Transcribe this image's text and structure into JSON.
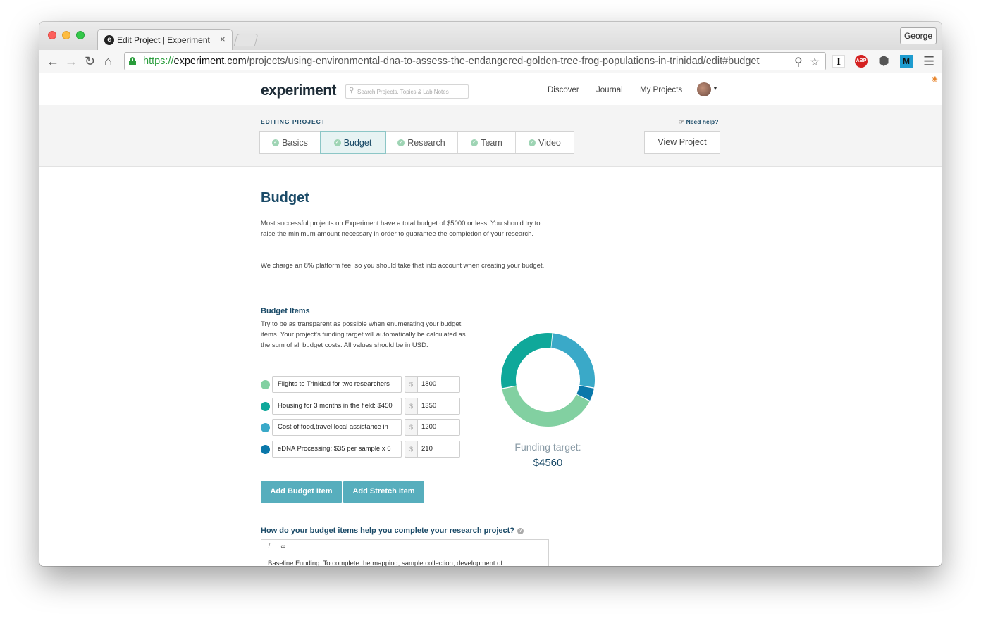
{
  "browser": {
    "tab_title": "Edit Project | Experiment",
    "tab_favicon": "e",
    "tab_close": "×",
    "profile_name": "George",
    "url_scheme": "https://",
    "url_host": "experiment.com",
    "url_path": "/projects/using-environmental-dna-to-assess-the-endangered-golden-tree-frog-populations-in-trinidad/edit#budget",
    "extensions": [
      {
        "name": "instapaper-extension-icon",
        "label": "I"
      },
      {
        "name": "adblock-plus-icon",
        "label": "ABP"
      },
      {
        "name": "hexagon-extension-icon",
        "label": "⬢"
      },
      {
        "name": "m-extension-icon",
        "label": "M"
      }
    ]
  },
  "site": {
    "logo": "experiment",
    "search_placeholder": "Search Projects, Topics & Lab Notes",
    "nav": [
      "Discover",
      "Journal",
      "My Projects"
    ]
  },
  "editing": {
    "label": "EDITING PROJECT",
    "help": "Need help?",
    "tabs": [
      "Basics",
      "Budget",
      "Research",
      "Team",
      "Video"
    ],
    "active_tab": "Budget",
    "view_project": "View Project"
  },
  "budget": {
    "title": "Budget",
    "intro": "Most successful projects on Experiment have a total budget of $5000 or less. You should try to raise the minimum amount necessary in order to guarantee the completion of your research.",
    "fee_note": "We charge an 8% platform fee, so you should take that into account when creating your budget.",
    "items_title": "Budget Items",
    "items_desc": "Try to be as transparent as possible when enumerating your budget items. Your project's funding target will automatically be calculated as the sum of all budget costs. All values should be in USD.",
    "currency_symbol": "$",
    "items": [
      {
        "description": "Flights to Trinidad for two researchers",
        "amount": "1800",
        "color": "#82d0a1"
      },
      {
        "description": "Housing for 3 months in the field: $450",
        "amount": "1350",
        "color": "#0fa89a"
      },
      {
        "description": "Cost of food,travel,local assistance in",
        "amount": "1200",
        "color": "#3aa9c8"
      },
      {
        "description": "eDNA Processing: $35 per sample x 6",
        "amount": "210",
        "color": "#0a78aa"
      }
    ],
    "funding_label": "Funding target:",
    "funding_value": "$4560",
    "add_budget_item": "Add Budget Item",
    "add_stretch_item": "Add Stretch Item",
    "question": "How do your budget items help you complete your research project?",
    "editor_tools": [
      "I",
      "∞"
    ],
    "editor_text": "Baseline Funding: To complete the mapping, sample collection, development of"
  }
}
